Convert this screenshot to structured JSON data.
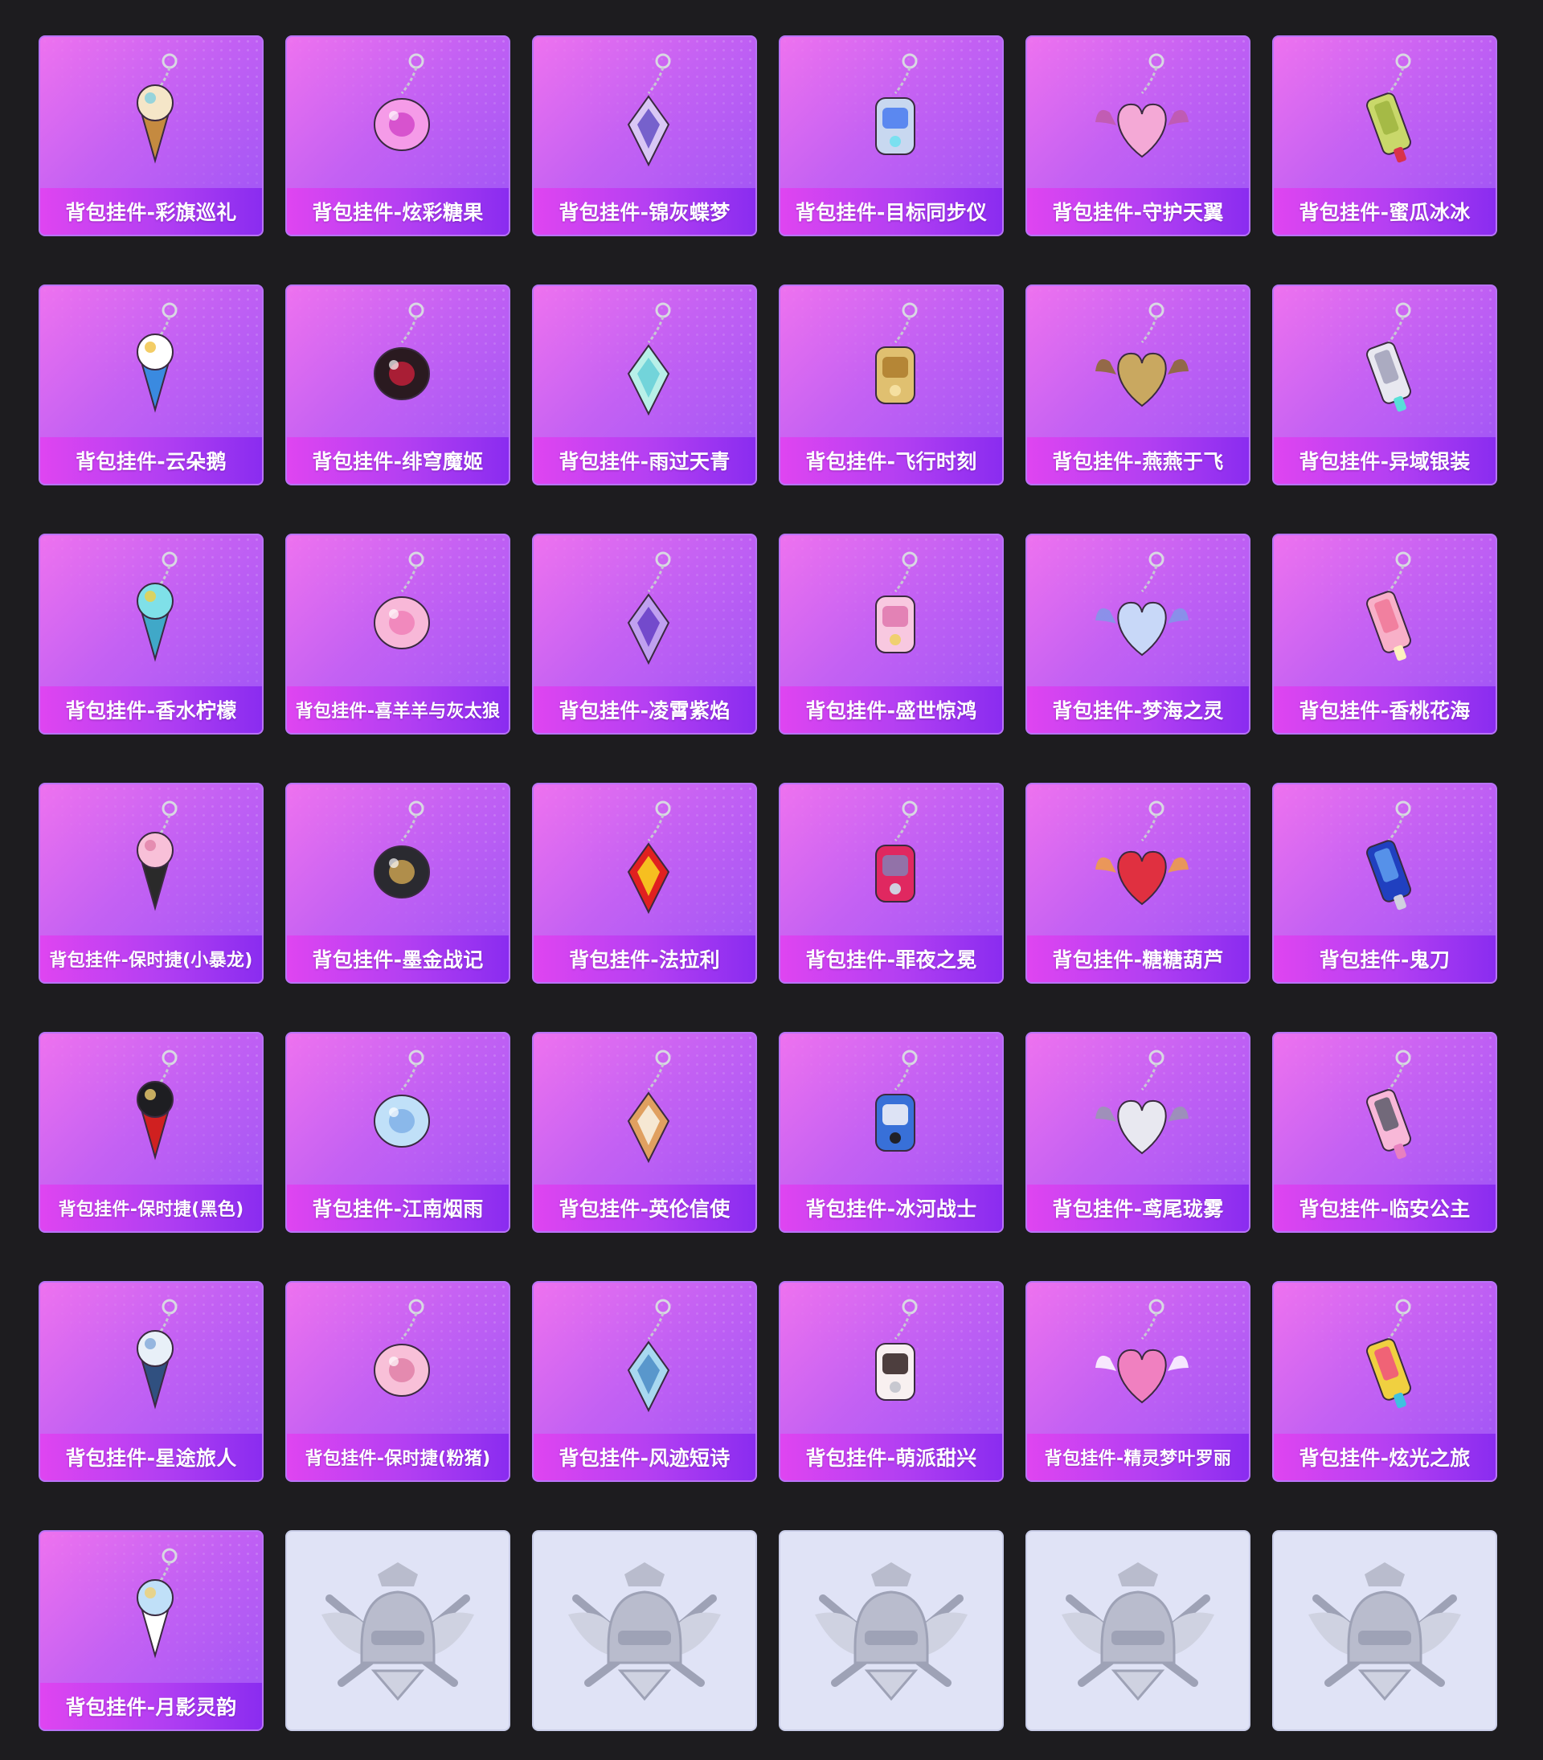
{
  "items": [
    {
      "label": "背包挂件-彩旗巡礼",
      "icon": "ice-cream-charm-icon",
      "colors": [
        "#f5e6c8",
        "#7fd0e0",
        "#c58a40"
      ]
    },
    {
      "label": "背包挂件-炫彩糖果",
      "icon": "candy-charm-icon",
      "colors": [
        "#f59be8",
        "#d146c9",
        "#f7c06a"
      ]
    },
    {
      "label": "背包挂件-锦灰蝶梦",
      "icon": "butterfly-tassel-charm-icon",
      "colors": [
        "#d9c7f5",
        "#6a55c8",
        "#3f2f7a"
      ]
    },
    {
      "label": "背包挂件-目标同步仪",
      "icon": "ring-charm-icon",
      "colors": [
        "#c8d8f0",
        "#4f7ff0",
        "#7ae0f0"
      ]
    },
    {
      "label": "背包挂件-守护天翼",
      "icon": "winged-heart-charm-icon",
      "colors": [
        "#f4a9d6",
        "#c05aa8",
        "#f0d070"
      ]
    },
    {
      "label": "背包挂件-蜜瓜冰冰",
      "icon": "popsicle-charm-icon",
      "colors": [
        "#c9d86a",
        "#9fb53f",
        "#d9324a"
      ]
    },
    {
      "label": "背包挂件-云朵鹅",
      "icon": "goose-badge-charm-icon",
      "colors": [
        "#ffffff",
        "#f0c040",
        "#3a8ae0"
      ]
    },
    {
      "label": "背包挂件-绯穹魔姬",
      "icon": "dark-wing-charm-icon",
      "colors": [
        "#2a1a20",
        "#c0203a",
        "#f0d070"
      ]
    },
    {
      "label": "背包挂件-雨过天青",
      "icon": "jade-tassel-charm-icon",
      "colors": [
        "#b8f0e8",
        "#6ad0d8",
        "#e0f8f8"
      ]
    },
    {
      "label": "背包挂件-飞行时刻",
      "icon": "airplane-charm-icon",
      "colors": [
        "#e0c070",
        "#b08030",
        "#f5e0a0"
      ]
    },
    {
      "label": "背包挂件-燕燕于飞",
      "icon": "swallow-charm-icon",
      "colors": [
        "#c9a860",
        "#8a6a2a",
        "#d04060"
      ]
    },
    {
      "label": "背包挂件-异域银装",
      "icon": "silver-wing-charm-icon",
      "colors": [
        "#e8e8f0",
        "#a0a0b8",
        "#58e0d8"
      ]
    },
    {
      "label": "背包挂件-香水柠檬",
      "icon": "lemon-drink-charm-icon",
      "colors": [
        "#7fe0e8",
        "#f0d040",
        "#40a8c8"
      ]
    },
    {
      "label": "背包挂件-喜羊羊与灰太狼",
      "icon": "pink-bow-charm-icon",
      "colors": [
        "#f8b8d8",
        "#f080b8",
        "#ffffff"
      ]
    },
    {
      "label": "背包挂件-凌霄紫焰",
      "icon": "purple-flame-charm-icon",
      "colors": [
        "#c0a0f0",
        "#6a40c8",
        "#f0d070"
      ]
    },
    {
      "label": "背包挂件-盛世惊鸿",
      "icon": "flower-crown-charm-icon",
      "colors": [
        "#f8c8e0",
        "#e07ab0",
        "#f0d070"
      ]
    },
    {
      "label": "背包挂件-梦海之灵",
      "icon": "shell-pearl-charm-icon",
      "colors": [
        "#c8d8f8",
        "#8098e8",
        "#ffffff"
      ]
    },
    {
      "label": "背包挂件-香桃花海",
      "icon": "peach-blossom-charm-icon",
      "colors": [
        "#f8b0c8",
        "#f07898",
        "#fff0c0"
      ]
    },
    {
      "label": "背包挂件-保时捷(小暴龙)",
      "icon": "car-key-pink-charm-icon",
      "colors": [
        "#f8c0d8",
        "#e080a8",
        "#2a2a2a"
      ]
    },
    {
      "label": "背包挂件-墨金战记",
      "icon": "black-crystal-charm-icon",
      "colors": [
        "#2a2a30",
        "#c8a050",
        "#505060"
      ]
    },
    {
      "label": "背包挂件-法拉利",
      "icon": "ferrari-shield-charm-icon",
      "colors": [
        "#e02020",
        "#f8d020",
        "#d0d0d8"
      ]
    },
    {
      "label": "背包挂件-罪夜之冕",
      "icon": "winged-heart-arrow-charm-icon",
      "colors": [
        "#e02860",
        "#8a7ab0",
        "#d0d0e0"
      ]
    },
    {
      "label": "背包挂件-糖糖葫芦",
      "icon": "candied-hawthorn-charm-icon",
      "colors": [
        "#e03040",
        "#f0a040",
        "#ffffff"
      ]
    },
    {
      "label": "背包挂件-鬼刀",
      "icon": "blue-crystal-charm-icon",
      "colors": [
        "#2040c0",
        "#60a0f0",
        "#d0d0e0"
      ]
    },
    {
      "label": "背包挂件-保时捷(黑色)",
      "icon": "car-key-black-charm-icon",
      "colors": [
        "#1e1e22",
        "#f0d070",
        "#d02020"
      ]
    },
    {
      "label": "背包挂件-江南烟雨",
      "icon": "blue-flower-charm-icon",
      "colors": [
        "#c0e0f8",
        "#80b0e8",
        "#ffffff"
      ]
    },
    {
      "label": "背包挂件-英伦信使",
      "icon": "pocket-watch-charm-icon",
      "colors": [
        "#e0a060",
        "#f8f0e0",
        "#70c8e0"
      ]
    },
    {
      "label": "背包挂件-冰河战士",
      "icon": "robot-charm-icon",
      "colors": [
        "#3870d8",
        "#f0f0f8",
        "#202028"
      ]
    },
    {
      "label": "背包挂件-鸢尾珑雾",
      "icon": "silver-butterfly-charm-icon",
      "colors": [
        "#e8e8f0",
        "#9898b0",
        "#50505a"
      ]
    },
    {
      "label": "背包挂件-临安公主",
      "icon": "pink-butterfly-arrow-charm-icon",
      "colors": [
        "#f8b8d8",
        "#5a5a6a",
        "#e880c0"
      ]
    },
    {
      "label": "背包挂件-星途旅人",
      "icon": "space-shuttle-charm-icon",
      "colors": [
        "#e8f0f8",
        "#80a8d8",
        "#305080"
      ]
    },
    {
      "label": "背包挂件-保时捷(粉猪)",
      "icon": "car-key-pig-charm-icon",
      "colors": [
        "#f8c0d8",
        "#e080a8",
        "#2a2a2a"
      ]
    },
    {
      "label": "背包挂件-风迹短诗",
      "icon": "blue-bag-charm-icon",
      "colors": [
        "#a8d8f0",
        "#5090c8",
        "#ffffff"
      ]
    },
    {
      "label": "背包挂件-萌派甜兴",
      "icon": "portrait-badge-charm-icon",
      "colors": [
        "#f8f0f0",
        "#3a2a2a",
        "#c8c8d0"
      ]
    },
    {
      "label": "背包挂件-精灵梦叶罗丽",
      "icon": "winged-heart-bow-charm-icon",
      "colors": [
        "#f080c0",
        "#ffffff",
        "#f0d070"
      ]
    },
    {
      "label": "背包挂件-炫光之旅",
      "icon": "rainbow-egg-charm-icon",
      "colors": [
        "#f0d040",
        "#f05080",
        "#40c0e0"
      ]
    },
    {
      "label": "背包挂件-月影灵韵",
      "icon": "moon-rabbit-charm-icon",
      "colors": [
        "#c0e0f8",
        "#f0d070",
        "#ffffff"
      ]
    },
    {
      "label": "",
      "icon": "placeholder-emblem-icon",
      "colors": []
    },
    {
      "label": "",
      "icon": "placeholder-emblem-icon",
      "colors": []
    },
    {
      "label": "",
      "icon": "placeholder-emblem-icon",
      "colors": []
    },
    {
      "label": "",
      "icon": "placeholder-emblem-icon",
      "colors": []
    },
    {
      "label": "",
      "icon": "placeholder-emblem-icon",
      "colors": []
    }
  ],
  "theme": {
    "page_background": "#1d1c1f",
    "card_gradient": [
      "#ee72ef",
      "#9d55f6"
    ],
    "label_bar_gradient": [
      "#df45f1",
      "#8a2cf0"
    ],
    "empty_card_background": "#e0e3f6"
  }
}
